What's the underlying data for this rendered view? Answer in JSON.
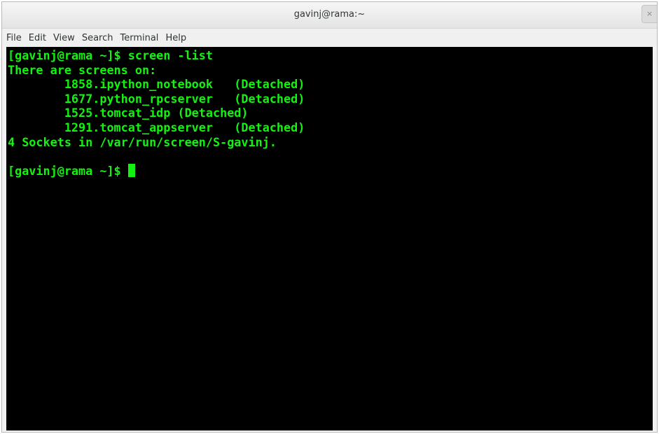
{
  "window": {
    "title": "gavinj@rama:~",
    "close_glyph": "×"
  },
  "menubar": {
    "items": [
      "File",
      "Edit",
      "View",
      "Search",
      "Terminal",
      "Help"
    ]
  },
  "terminal": {
    "lines": [
      "[gavinj@rama ~]$ screen -list",
      "There are screens on:",
      "        1858.ipython_notebook   (Detached)",
      "        1677.python_rpcserver   (Detached)",
      "        1525.tomcat_idp (Detached)",
      "        1291.tomcat_appserver   (Detached)",
      "4 Sockets in /var/run/screen/S-gavinj.",
      "",
      "[gavinj@rama ~]$ "
    ],
    "text_color": "#13f210",
    "background": "#000000"
  }
}
